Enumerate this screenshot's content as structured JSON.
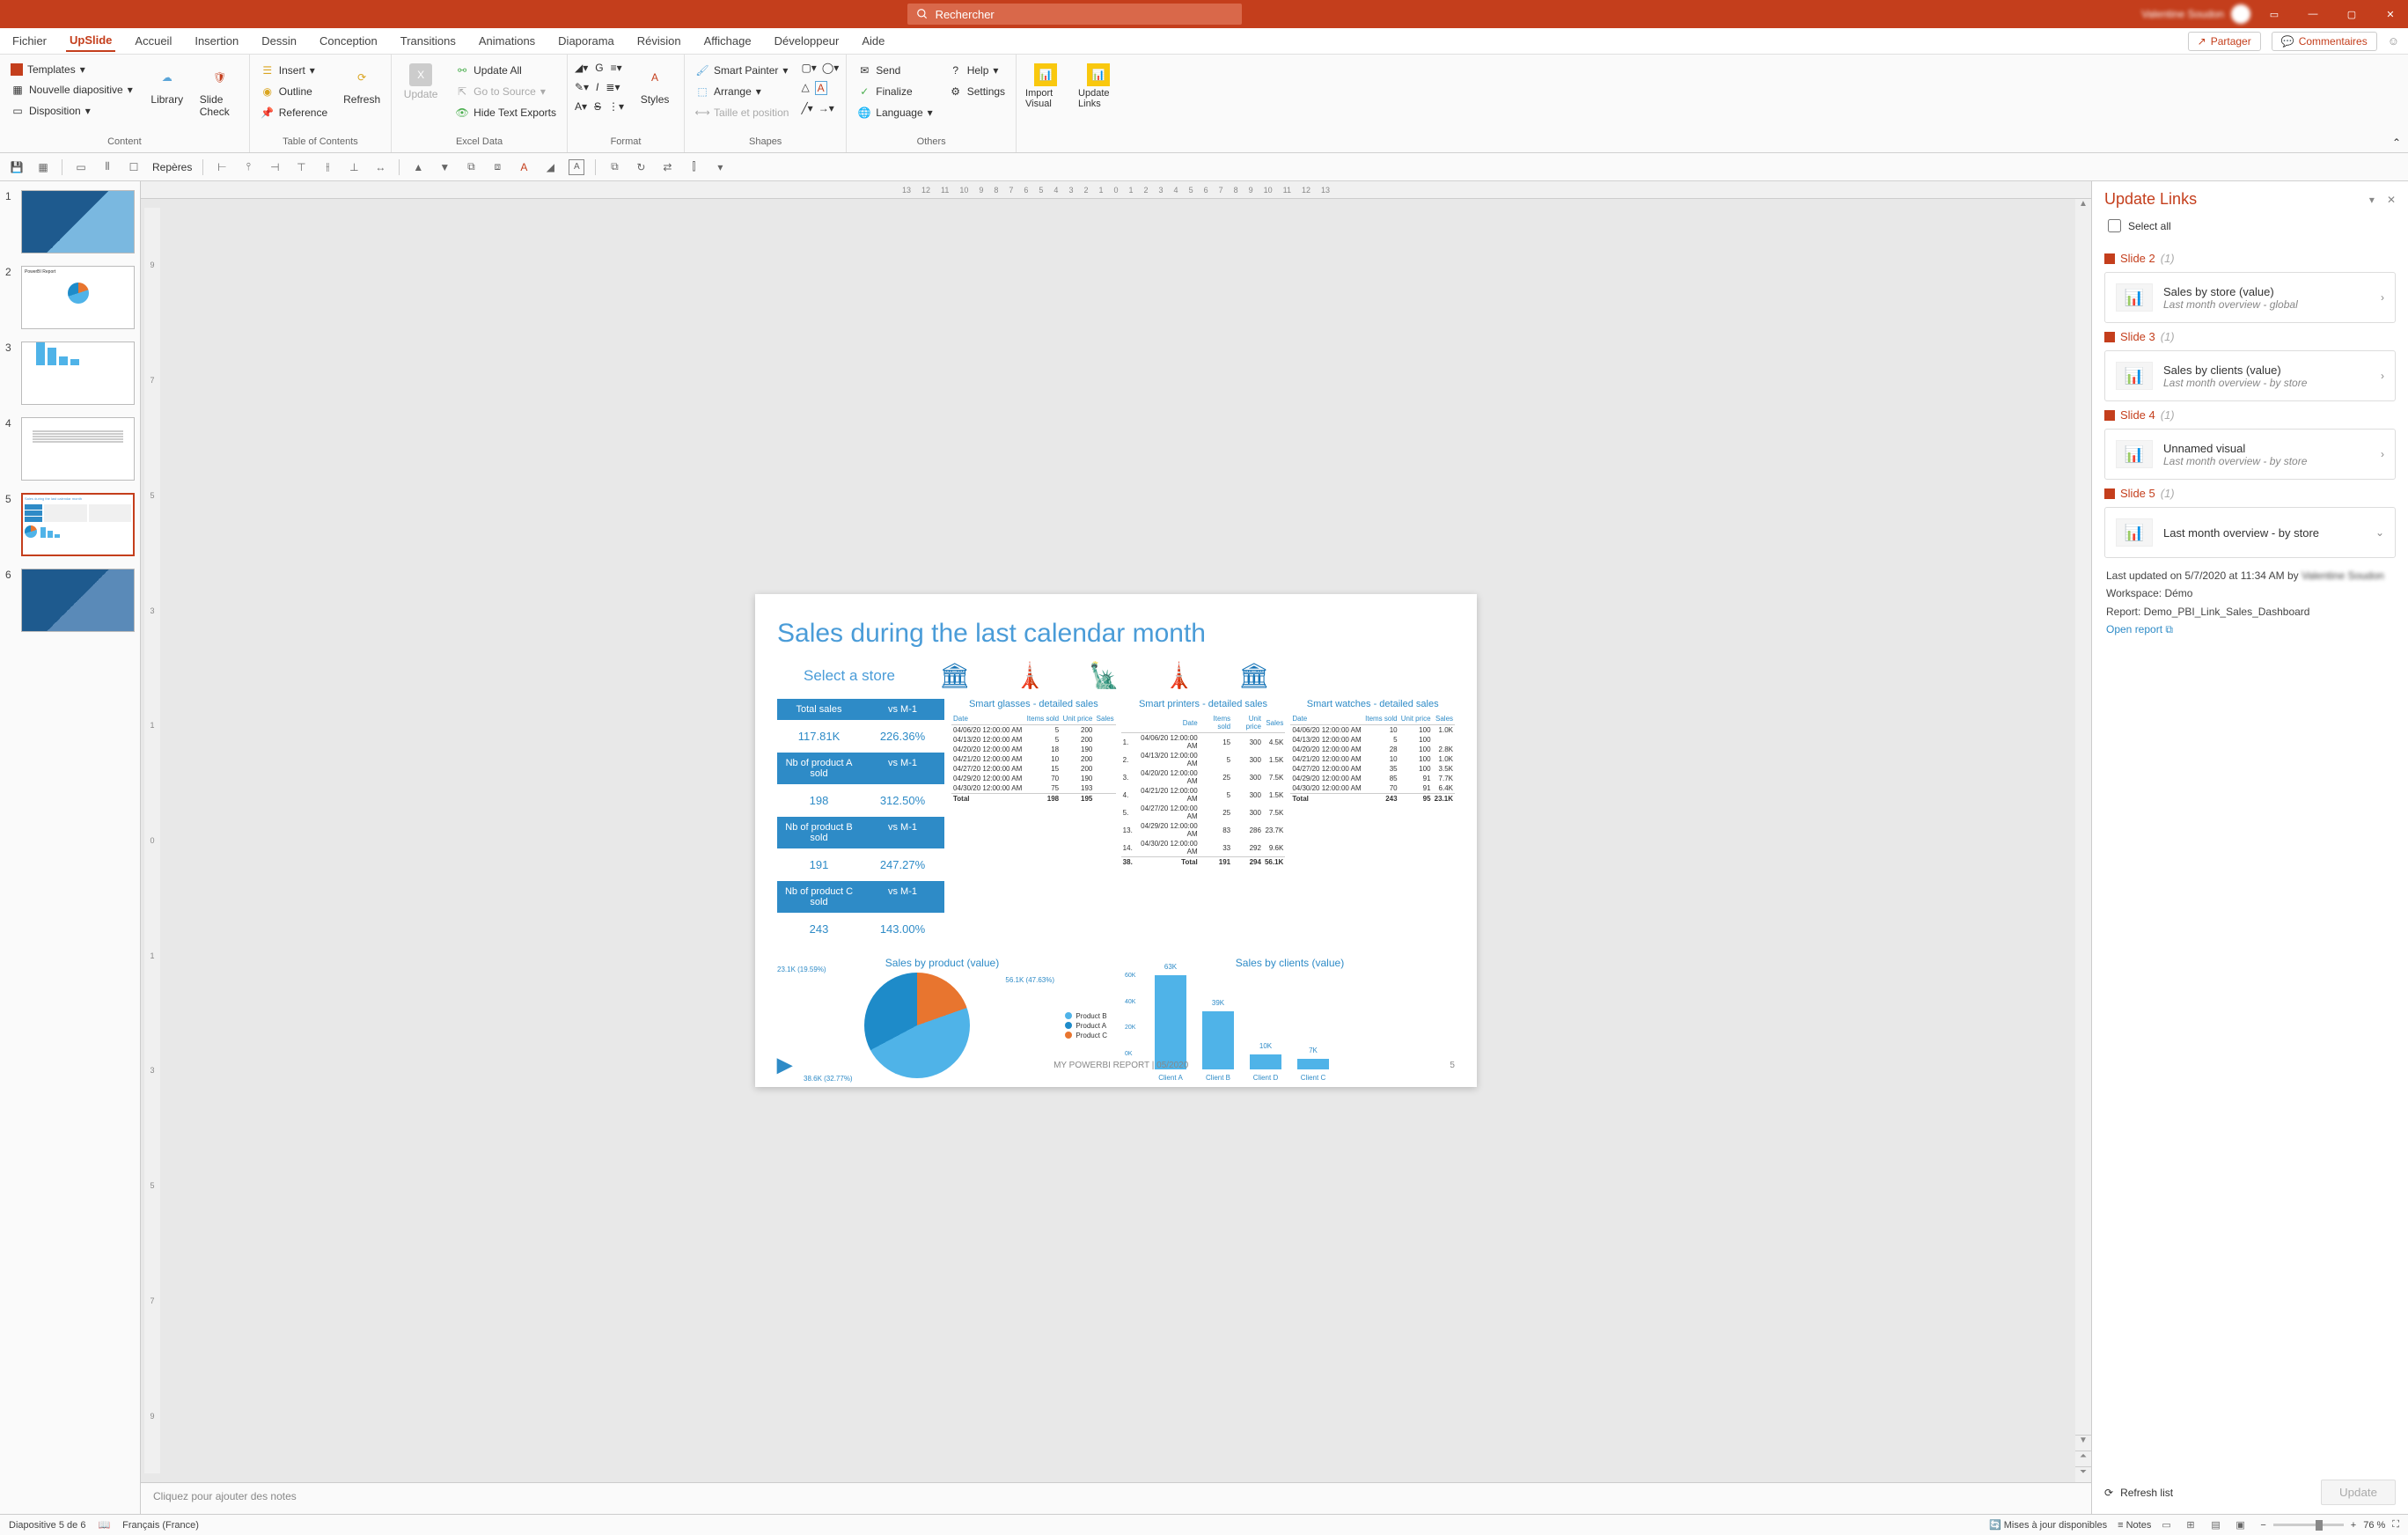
{
  "search_placeholder": "Rechercher",
  "user_name": "Valentine Soudon",
  "menu": {
    "tabs": [
      "Fichier",
      "UpSlide",
      "Accueil",
      "Insertion",
      "Dessin",
      "Conception",
      "Transitions",
      "Animations",
      "Diaporama",
      "Révision",
      "Affichage",
      "Développeur",
      "Aide"
    ],
    "active": "UpSlide",
    "share": "Partager",
    "comments": "Commentaires"
  },
  "ribbon": {
    "content": {
      "label": "Content",
      "templates": "Templates",
      "new_slide": "Nouvelle diapositive",
      "layout": "Disposition",
      "library": "Library",
      "slide_check": "Slide Check"
    },
    "toc": {
      "label": "Table of Contents",
      "insert": "Insert",
      "outline": "Outline",
      "reference": "Reference",
      "refresh": "Refresh"
    },
    "excel": {
      "label": "Excel Data",
      "update": "Update",
      "update_all": "Update All",
      "go_source": "Go to Source",
      "hide_text": "Hide Text Exports"
    },
    "format": {
      "label": "Format",
      "styles": "Styles"
    },
    "shapes": {
      "label": "Shapes",
      "smart_painter": "Smart Painter",
      "arrange": "Arrange",
      "taille": "Taille et position"
    },
    "others": {
      "label": "Others",
      "send": "Send",
      "finalize": "Finalize",
      "language": "Language",
      "help": "Help",
      "settings": "Settings"
    },
    "import_visual": "Import Visual",
    "update_links": "Update Links"
  },
  "qat": {
    "reperes": "Repères"
  },
  "thumbs": [
    1,
    2,
    3,
    4,
    5,
    6
  ],
  "selected_thumb": 5,
  "slide": {
    "title": "Sales during the last calendar month",
    "select_store": "Select a store",
    "kpi_headers": [
      [
        "Total sales",
        "vs M-1"
      ],
      [
        "Nb of product A sold",
        "vs M-1"
      ],
      [
        "Nb of product B sold",
        "vs M-1"
      ],
      [
        "Nb of product C sold",
        "vs M-1"
      ]
    ],
    "kpi_values": [
      [
        "117.81K",
        "226.36%"
      ],
      [
        "198",
        "312.50%"
      ],
      [
        "191",
        "247.27%"
      ],
      [
        "243",
        "143.00%"
      ]
    ],
    "table_titles": [
      "Smart glasses - detailed sales",
      "Smart printers - detailed sales",
      "Smart watches - detailed sales"
    ],
    "table_headers": [
      "Date",
      "Items sold",
      "Unit price",
      "Sales"
    ],
    "table_headers2": [
      "",
      "Date",
      "Items sold",
      "Unit price",
      "Sales"
    ],
    "table1": [
      [
        "04/06/20 12:00:00 AM",
        "5",
        "200",
        ""
      ],
      [
        "04/13/20 12:00:00 AM",
        "5",
        "200",
        ""
      ],
      [
        "04/20/20 12:00:00 AM",
        "18",
        "190",
        ""
      ],
      [
        "04/21/20 12:00:00 AM",
        "10",
        "200",
        ""
      ],
      [
        "04/27/20 12:00:00 AM",
        "15",
        "200",
        ""
      ],
      [
        "04/29/20 12:00:00 AM",
        "70",
        "190",
        ""
      ],
      [
        "04/30/20 12:00:00 AM",
        "75",
        "193",
        ""
      ]
    ],
    "table1_total": [
      "Total",
      "198",
      "195",
      ""
    ],
    "table2": [
      [
        "1.",
        "04/06/20 12:00:00 AM",
        "15",
        "300",
        "4.5K"
      ],
      [
        "2.",
        "04/13/20 12:00:00 AM",
        "5",
        "300",
        "1.5K"
      ],
      [
        "3.",
        "04/20/20 12:00:00 AM",
        "25",
        "300",
        "7.5K"
      ],
      [
        "4.",
        "04/21/20 12:00:00 AM",
        "5",
        "300",
        "1.5K"
      ],
      [
        "5.",
        "04/27/20 12:00:00 AM",
        "25",
        "300",
        "7.5K"
      ],
      [
        "13.",
        "04/29/20 12:00:00 AM",
        "83",
        "286",
        "23.7K"
      ],
      [
        "14.",
        "04/30/20 12:00:00 AM",
        "33",
        "292",
        "9.6K"
      ]
    ],
    "table2_total": [
      "38.",
      "Total",
      "191",
      "294",
      "56.1K"
    ],
    "table3": [
      [
        "04/06/20 12:00:00 AM",
        "10",
        "100",
        "1.0K"
      ],
      [
        "04/13/20 12:00:00 AM",
        "5",
        "100",
        ""
      ],
      [
        "04/20/20 12:00:00 AM",
        "28",
        "100",
        "2.8K"
      ],
      [
        "04/21/20 12:00:00 AM",
        "10",
        "100",
        "1.0K"
      ],
      [
        "04/27/20 12:00:00 AM",
        "35",
        "100",
        "3.5K"
      ],
      [
        "04/29/20 12:00:00 AM",
        "85",
        "91",
        "7.7K"
      ],
      [
        "04/30/20 12:00:00 AM",
        "70",
        "91",
        "6.4K"
      ]
    ],
    "table3_total": [
      "Total",
      "243",
      "95",
      "23.1K"
    ],
    "pie_title": "Sales by product (value)",
    "bars_title": "Sales by clients (value)",
    "footer": "MY POWERBI REPORT | 05/2020",
    "pagenum": "5"
  },
  "chart_data": [
    {
      "type": "pie",
      "title": "Sales by product (value)",
      "series": [
        {
          "name": "Product B",
          "value": 56.1,
          "pct": 47.63,
          "color": "#4fb3e8"
        },
        {
          "name": "Product A",
          "value": 38.6,
          "pct": 32.77,
          "color": "#1e8bc9"
        },
        {
          "name": "Product C",
          "value": 23.1,
          "pct": 19.59,
          "color": "#e8752f"
        }
      ]
    },
    {
      "type": "bar",
      "title": "Sales by clients (value)",
      "categories": [
        "Client A",
        "Client B",
        "Client D",
        "Client C"
      ],
      "values": [
        63,
        39,
        10,
        7
      ],
      "value_suffix": "K",
      "yticks": [
        "0K",
        "20K",
        "40K",
        "60K"
      ],
      "ylim": [
        0,
        65
      ]
    }
  ],
  "notes_placeholder": "Cliquez pour ajouter des notes",
  "panel": {
    "title": "Update Links",
    "select_all": "Select all",
    "slides": [
      {
        "h": "Slide 2",
        "cnt": "(1)",
        "cards": [
          {
            "t1": "Sales by store (value)",
            "t2": "Last month overview - global"
          }
        ]
      },
      {
        "h": "Slide 3",
        "cnt": "(1)",
        "cards": [
          {
            "t1": "Sales by clients (value)",
            "t2": "Last month overview - by store"
          }
        ]
      },
      {
        "h": "Slide 4",
        "cnt": "(1)",
        "cards": [
          {
            "t1": "Unnamed visual",
            "t2": "Last month overview - by store"
          }
        ]
      },
      {
        "h": "Slide 5",
        "cnt": "(1)",
        "cards": [
          {
            "t1": "Last month overview - by store",
            "t2": "",
            "expanded": true
          }
        ]
      }
    ],
    "details": {
      "updated": "Last updated on 5/7/2020 at 11:34 AM by",
      "user": "Valentine Soudon",
      "workspace": "Workspace: Démo",
      "report": "Report: Demo_PBI_Link_Sales_Dashboard",
      "open": "Open report"
    },
    "refresh": "Refresh list",
    "update": "Update"
  },
  "status": {
    "slide": "Diapositive 5 de 6",
    "lang": "Français (France)",
    "updates": "Mises à jour disponibles",
    "notes": "Notes",
    "zoom": "76 %"
  }
}
